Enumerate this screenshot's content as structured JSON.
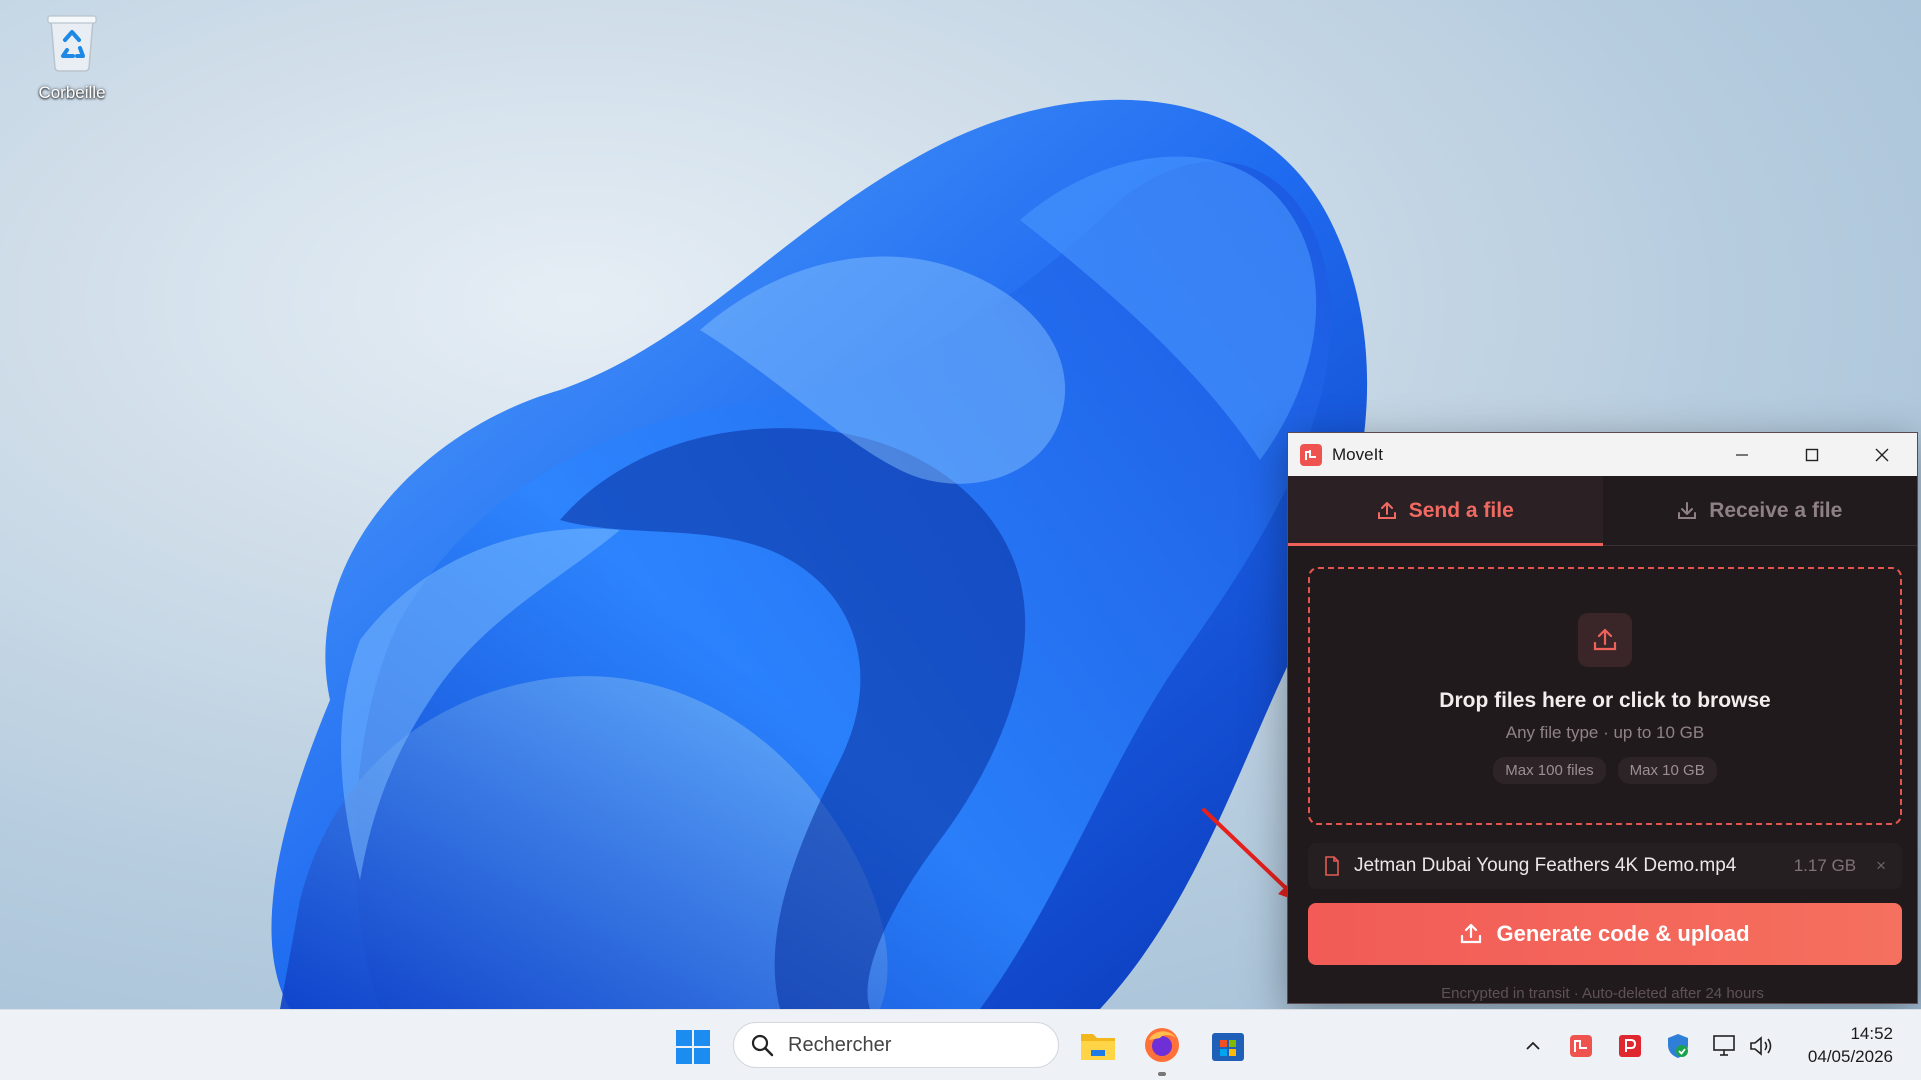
{
  "desktop": {
    "icons": [
      {
        "label": "Corbeille"
      }
    ]
  },
  "window": {
    "title": "MoveIt",
    "tabs": [
      {
        "label": "Send a file",
        "icon": "upload-icon",
        "active": true
      },
      {
        "label": "Receive a file",
        "icon": "download-icon",
        "active": false
      }
    ],
    "dropzone": {
      "title": "Drop files here or click to browse",
      "subtitle": "Any file type · up to 10 GB",
      "chips": [
        "Max 100 files",
        "Max 10 GB"
      ]
    },
    "file": {
      "name": "Jetman Dubai Young Feathers 4K Demo.mp4",
      "size": "1.17 GB",
      "remove": "×"
    },
    "primary_button": "Generate code & upload",
    "footer_note": "Encrypted in transit · Auto-deleted after 24 hours"
  },
  "taskbar": {
    "search_placeholder": "Rechercher",
    "time": "14:52",
    "date": "04/05/2026"
  },
  "colors": {
    "accent": "#f0615a",
    "window_bg": "#201a1d",
    "taskbar_bg": "#eef1f5"
  }
}
